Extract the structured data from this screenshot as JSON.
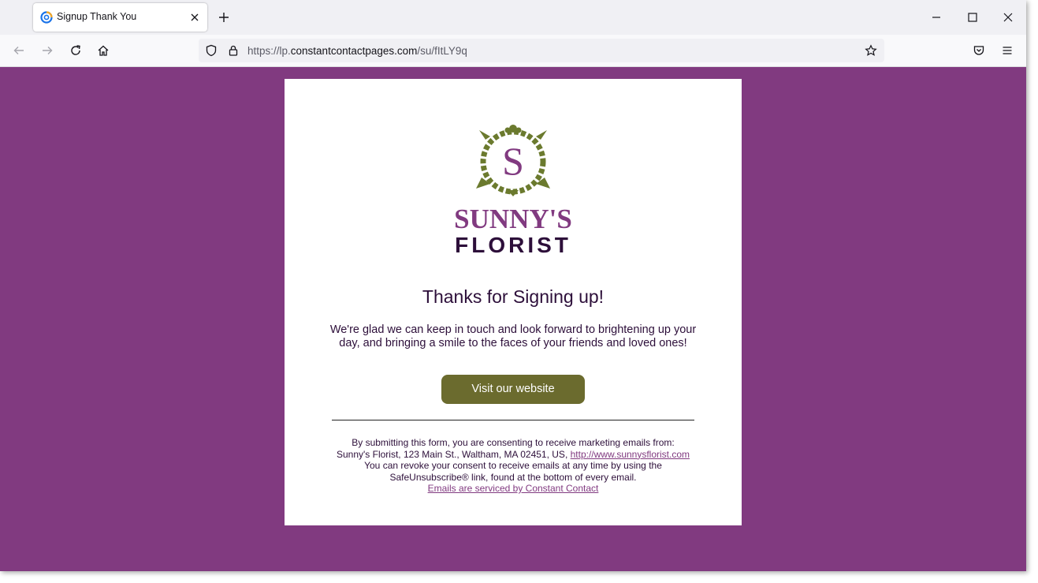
{
  "browser": {
    "tab": {
      "title": "Signup Thank You"
    },
    "url": {
      "scheme": "https://lp.",
      "host": "constantcontactpages.com",
      "path": "/su/fItLY9q"
    }
  },
  "page": {
    "logo": {
      "brand_line1": "SUNNY'S",
      "brand_line2": "FLORIST",
      "monogram": "S"
    },
    "heading": "Thanks for Signing up!",
    "message": "We're glad we can keep in touch and look forward to brightening up your day, and bringing a smile to the faces of your friends and loved ones!",
    "cta_label": "Visit our website",
    "footer": {
      "line1": "By submitting this form, you are consenting to receive marketing emails from:",
      "line2": "Sunny's Florist, 123 Main St., Waltham, MA 02451, US,",
      "website_link": "http://www.sunnysflorist.com",
      "line3": "You can revoke your consent to receive emails at any time by using the",
      "line4": "SafeUnsubscribe® link, found at the bottom of every email.",
      "service_link": "Emails are serviced by Constant Contact"
    }
  },
  "colors": {
    "page_background": "#813a80",
    "button_background": "#6b6b2e",
    "brand_purple": "#813a80",
    "brand_green": "#6b7a2e",
    "text_dark": "#2d0f3a"
  }
}
